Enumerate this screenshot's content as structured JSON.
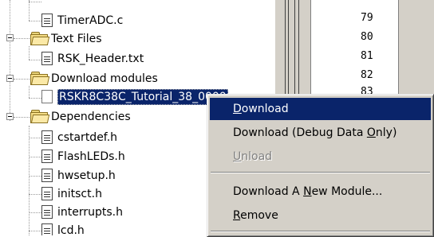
{
  "tree": {
    "items": [
      {
        "label": "TimerADC.c",
        "type": "file"
      },
      {
        "label": "Text Files",
        "type": "folder"
      },
      {
        "label": "RSK_Header.txt",
        "type": "file"
      },
      {
        "label": "Download modules",
        "type": "folder"
      },
      {
        "label": "RSKR8C38C_Tutorial_38_0000",
        "type": "module",
        "selected": true
      },
      {
        "label": "Dependencies",
        "type": "folder"
      },
      {
        "label": "cstartdef.h",
        "type": "file"
      },
      {
        "label": "FlashLEDs.h",
        "type": "file"
      },
      {
        "label": "hwsetup.h",
        "type": "file"
      },
      {
        "label": "initsct.h",
        "type": "file"
      },
      {
        "label": "interrupts.h",
        "type": "file"
      },
      {
        "label": "lcd.h",
        "type": "file"
      }
    ]
  },
  "editor": {
    "line_numbers": [
      "79",
      "80",
      "81",
      "82",
      "83"
    ]
  },
  "context_menu": {
    "items": [
      {
        "label": "Download",
        "mnemonic": "D",
        "highlighted": true
      },
      {
        "label": "Download (Debug Data Only)",
        "mnemonic": "O"
      },
      {
        "label": "Unload",
        "mnemonic": "U",
        "disabled": true
      },
      {
        "label": "Download A New Module...",
        "mnemonic": "N"
      },
      {
        "label": "Remove",
        "mnemonic": "R"
      }
    ]
  },
  "colors": {
    "selection": "#0a246a",
    "menu_face": "#d4d0c8",
    "disabled_text": "#808080"
  }
}
